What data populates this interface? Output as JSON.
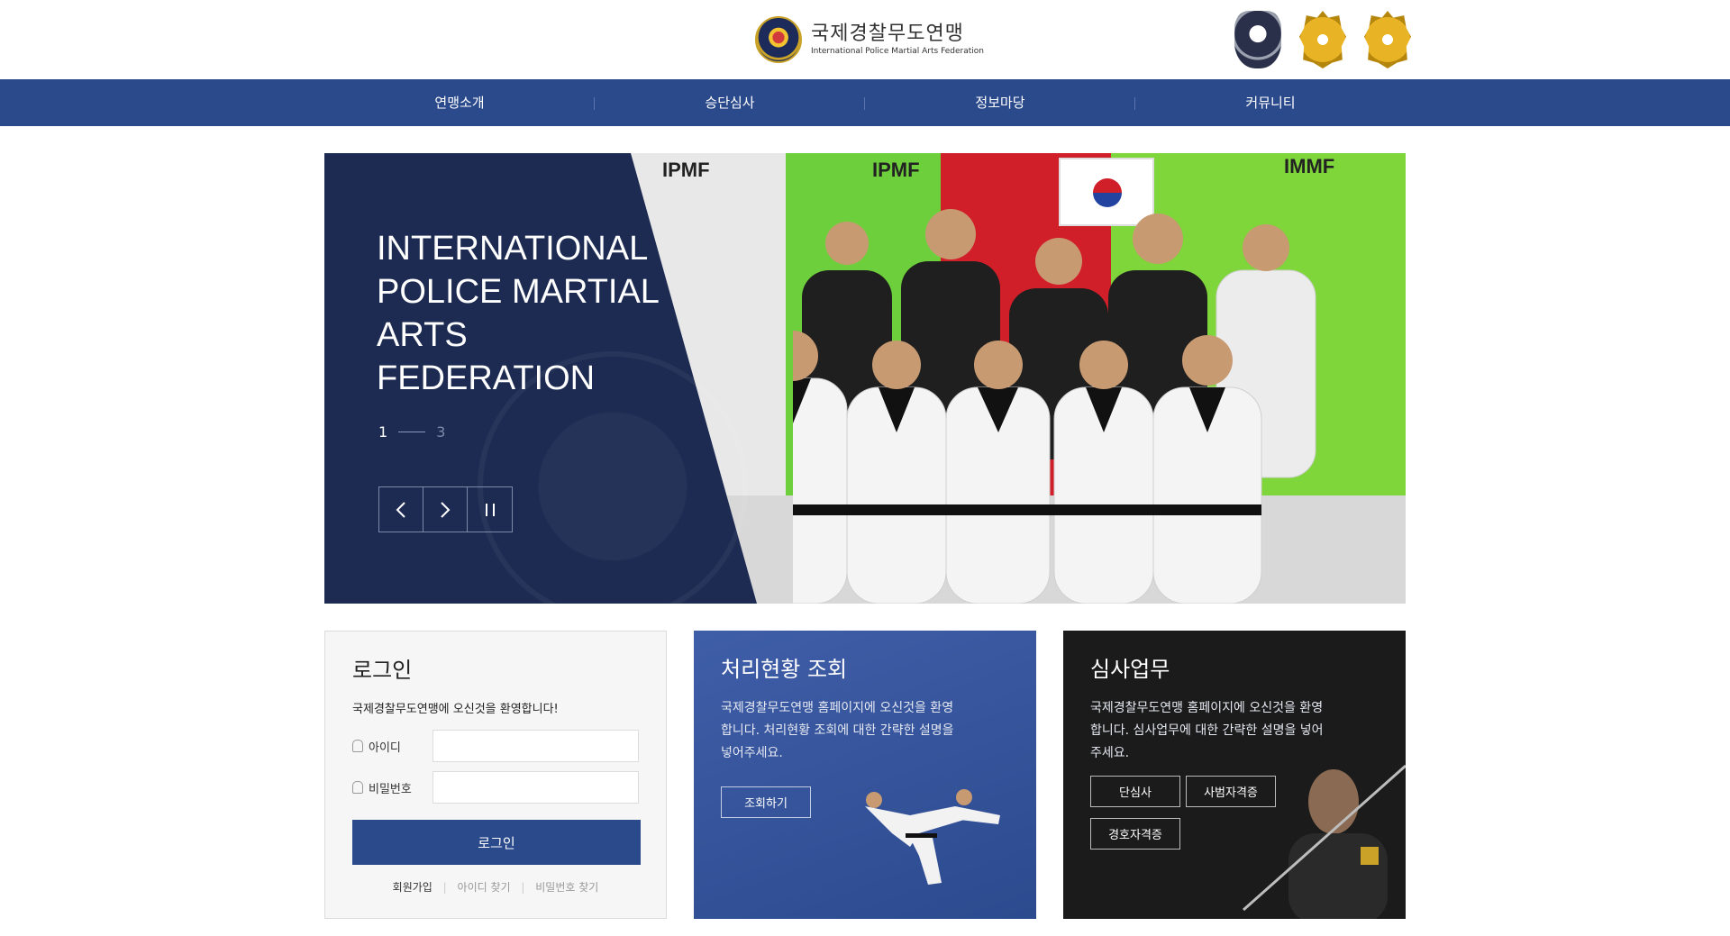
{
  "header": {
    "org_name_kr": "국제경찰무도연맹",
    "org_name_en": "International Police Martial Arts Federation",
    "badges": [
      "ipmf-shield-icon",
      "impga-badge-icon",
      "ipmf-badge-icon"
    ]
  },
  "nav": {
    "items": [
      {
        "label": "연맹소개"
      },
      {
        "label": "승단심사"
      },
      {
        "label": "정보마당"
      },
      {
        "label": "커뮤니티"
      }
    ]
  },
  "hero": {
    "title": "INTERNATIONAL POLICE MARTIAL ARTS FEDERATION",
    "current_slide": "1",
    "total_slides": "3",
    "photo_signs": [
      "IPMF",
      "IPMF",
      "IMMF"
    ],
    "controls": [
      "chevron-left-icon",
      "chevron-right-icon",
      "pause-icon"
    ]
  },
  "login": {
    "title": "로그인",
    "welcome": "국제경찰무도연맹에 오신것을 환영합니다!",
    "id_label": "아이디",
    "password_label": "비밀번호",
    "button_label": "로그인",
    "links": {
      "join": "회원가입",
      "find_id": "아이디 찾기",
      "find_password": "비밀번호 찾기"
    }
  },
  "status": {
    "title": "처리현황 조회",
    "description": "국제경찰무도연맹 홈페이지에 오신것을 환영합니다. 처리현황 조회에 대한 간략한 설명을 넣어주세요.",
    "button_label": "조회하기"
  },
  "exam": {
    "title": "심사업무",
    "description": "국제경찰무도연맹 홈페이지에 오신것을 환영합니다. 심사업무에 대한 간략한 설명을 넣어주세요.",
    "buttons": [
      "단심사",
      "사범자격증",
      "경호자격증"
    ]
  },
  "colors": {
    "nav": "#2b4a8c",
    "hero_panel": "#1d2b52",
    "status_bg": "#3a5aa3",
    "exam_bg": "#1b1b1b"
  }
}
